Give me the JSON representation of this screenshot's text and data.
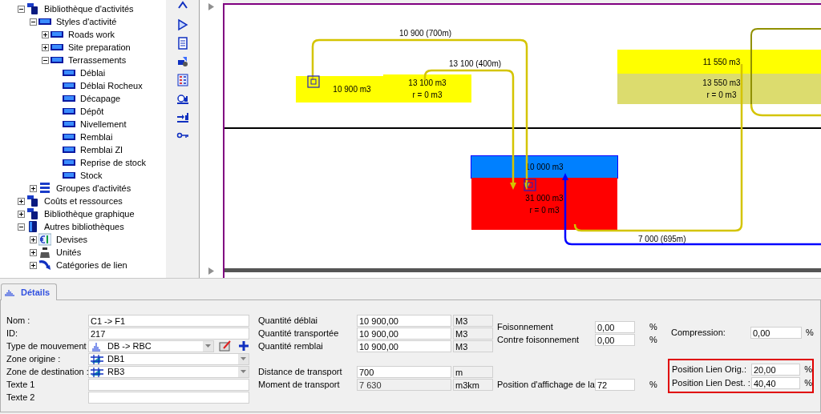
{
  "tree": [
    {
      "label": "Bibliothèque d'activités",
      "expanded": true,
      "children": [
        {
          "label": "Styles d'activité",
          "expanded": true,
          "children": [
            {
              "label": "Roads work",
              "expanded": false
            },
            {
              "label": "Site preparation",
              "expanded": false
            },
            {
              "label": "Terrassements",
              "expanded": true,
              "children": [
                {
                  "label": "Déblai"
                },
                {
                  "label": "Déblai Rocheux"
                },
                {
                  "label": "Décapage"
                },
                {
                  "label": "Dépôt"
                },
                {
                  "label": "Nivellement"
                },
                {
                  "label": "Remblai"
                },
                {
                  "label": "Remblai ZI"
                },
                {
                  "label": "Reprise de stock"
                },
                {
                  "label": "Stock"
                }
              ]
            }
          ]
        },
        {
          "label": "Groupes d'activités",
          "expanded": false
        }
      ]
    },
    {
      "label": "Coûts et ressources",
      "expanded": false
    },
    {
      "label": "Bibliothèque graphique",
      "expanded": false
    },
    {
      "label": "Autres bibliothèques",
      "expanded": true,
      "children": [
        {
          "label": "Devises",
          "expanded": false
        },
        {
          "label": "Unités",
          "expanded": false
        },
        {
          "label": "Catégories de lien",
          "expanded": false
        }
      ]
    }
  ],
  "diagram": {
    "blocks": [
      {
        "lines": [
          "10 900 m3"
        ],
        "color": "#ffff00"
      },
      {
        "lines": [
          "13 100 m3",
          "r = 0 m3"
        ],
        "color": "#ffff00"
      },
      {
        "lines": [
          "11 550 m3"
        ],
        "color": "#ffff00"
      },
      {
        "lines": [
          "13 550 m3",
          "r = 0 m3"
        ],
        "color": "#dcdc6e"
      },
      {
        "lines": [
          "10 000 m3"
        ],
        "color": "#0080ff"
      },
      {
        "lines": [
          "31 000 m3",
          "r = 0 m3"
        ],
        "color": "#ff0000"
      }
    ],
    "links": [
      {
        "label": "10 900 (700m)",
        "color": "#d4c400"
      },
      {
        "label": "13 100 (400m)",
        "color": "#d4c400"
      },
      {
        "label": "7 000 (695m)",
        "color": "#0000ff"
      }
    ]
  },
  "details": {
    "tabs": [
      {
        "label": "Détails",
        "selected": true
      }
    ],
    "col1": [
      {
        "label": "Nom :",
        "kind": "text",
        "value": "C1 -> F1"
      },
      {
        "label": "ID:",
        "kind": "text",
        "value": "217"
      },
      {
        "label": "Type de mouvement",
        "kind": "combo-actions",
        "value": "DB -> RBC"
      },
      {
        "label": "Zone origine :",
        "kind": "combo",
        "value": "DB1"
      },
      {
        "label": "Zone de destination :",
        "kind": "combo",
        "value": "RB3"
      },
      {
        "label": "Texte 1",
        "kind": "text"
      },
      {
        "label": "Texte 2",
        "kind": "text"
      }
    ],
    "col2": [
      {
        "label": "Quantité déblai",
        "value": "10 900,00",
        "unit": "M3",
        "readonly": false
      },
      {
        "label": "Quantité transportée",
        "value": "10 900,00",
        "unit": "M3",
        "readonly": false
      },
      {
        "label": "Quantité remblai",
        "value": "10 900,00",
        "unit": "M3",
        "readonly": false
      },
      {
        "label": "Distance de transport",
        "value": "700",
        "unit": "m",
        "readonly": false
      },
      {
        "label": "Moment de transport",
        "value": "7 630",
        "unit": "m3km",
        "readonly": true
      }
    ],
    "col3": [
      {
        "label": "Foisonnement",
        "value": "0,00",
        "unit": "%"
      },
      {
        "label": "Contre foisonnement",
        "value": "0,00",
        "unit": "%"
      },
      {
        "label": "Position d'affichage de la",
        "value": "72",
        "unit": "%"
      }
    ],
    "col4": [
      {
        "label": "Compression:",
        "value": "0,00",
        "unit": "%",
        "highlighted": false
      },
      {
        "label": "Position Lien Orig.:",
        "value": "20,00",
        "unit": "%",
        "highlighted": true
      },
      {
        "label": "Position Lien Dest. :",
        "value": "40,40",
        "unit": "%",
        "highlighted": true
      }
    ]
  }
}
